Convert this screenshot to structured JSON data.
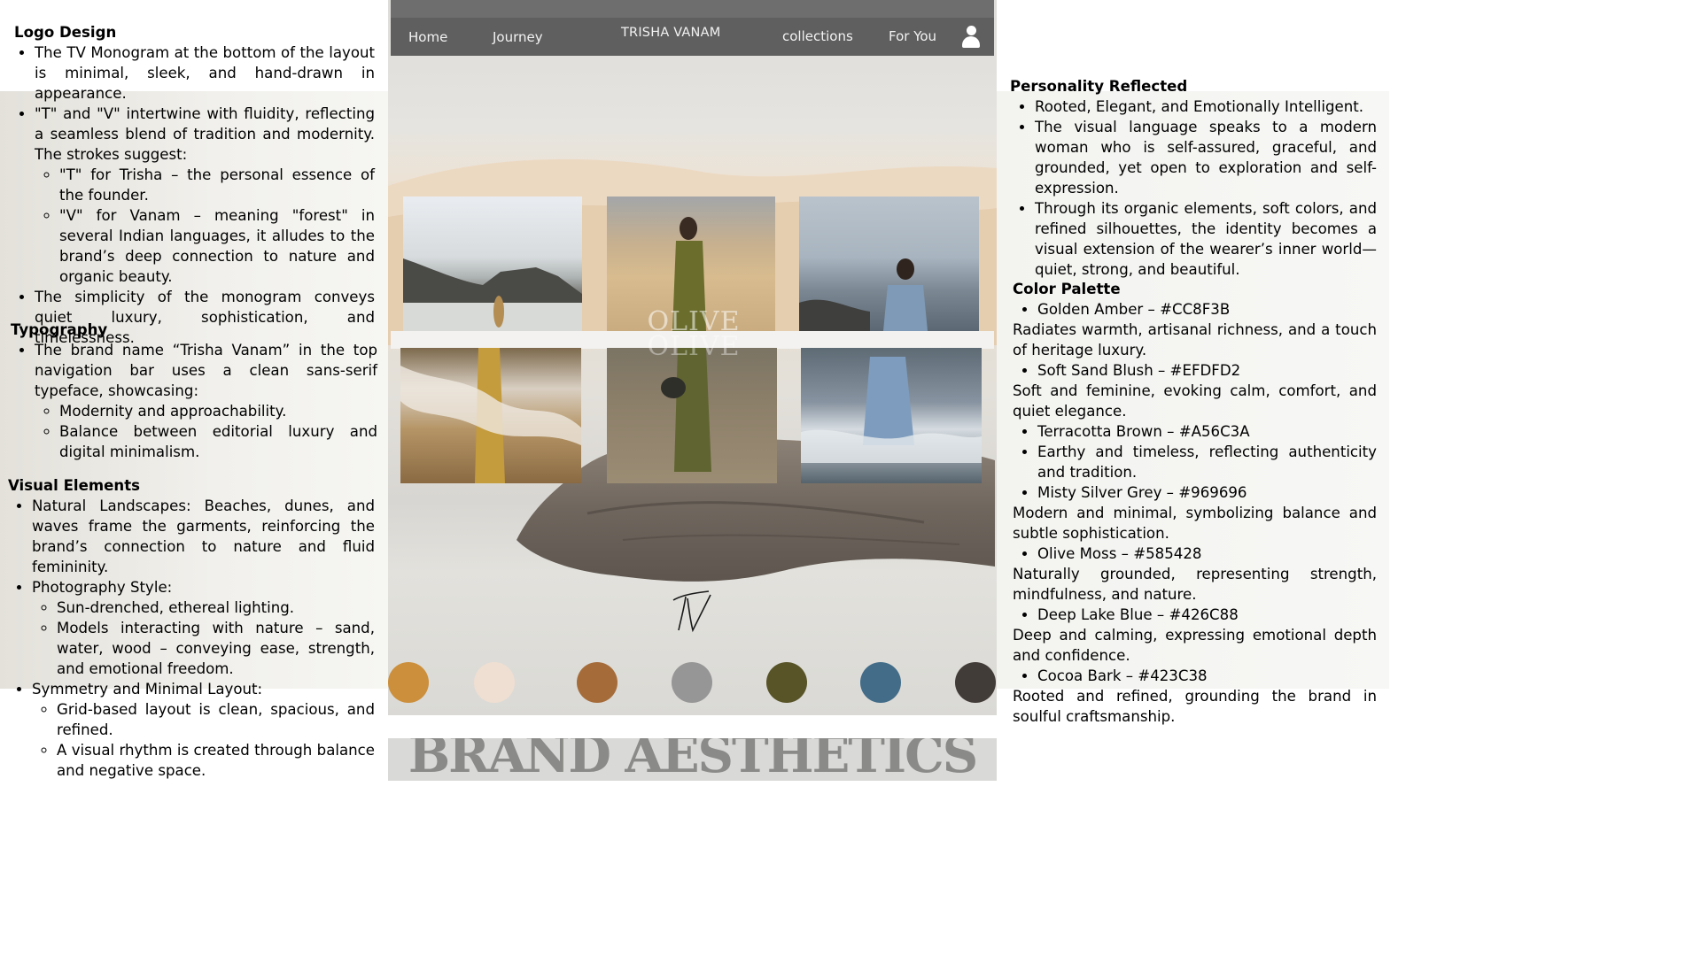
{
  "left": {
    "logo_design": {
      "heading": "Logo Design",
      "b1": "The TV Monogram at the bottom of the layout is minimal, sleek, and hand-drawn in appearance.",
      "b2": "\"T\" and \"V\" intertwine with fluidity, reflecting a seamless blend of tradition and modernity. The strokes suggest:",
      "b2a": "\"T\" for Trisha – the personal essence of the founder.",
      "b2b": "\"V\" for Vanam – meaning \"forest\" in several Indian languages, it alludes to the brand’s deep connection to nature and organic beauty.",
      "b3": "The simplicity of the monogram conveys quiet luxury, sophistication, and timelessness."
    },
    "typography": {
      "heading": "Typography",
      "b1": "The brand name “Trisha Vanam” in the top navigation bar uses a clean sans-serif typeface, showcasing:",
      "b1a": "Modernity and approachability.",
      "b1b": "Balance between editorial luxury and digital minimalism."
    },
    "visual_elements": {
      "heading": "Visual Elements",
      "b1": "Natural Landscapes: Beaches, dunes, and waves frame the garments, reinforcing the brand’s connection to nature and fluid femininity.",
      "b2": "Photography Style:",
      "b2a": "Sun-drenched, ethereal lighting.",
      "b2b": "Models interacting with nature – sand, water, wood – conveying ease, strength, and emotional freedom.",
      "b3": "Symmetry and Minimal Layout:",
      "b3a": "Grid-based layout is clean, spacious, and refined.",
      "b3b": "A visual rhythm is created through balance and negative space."
    }
  },
  "nav": {
    "home": "Home",
    "journey": "Journey",
    "brand": "TRISHA VANAM",
    "collections": "collections",
    "for_you": "For You",
    "user_icon": "user-icon"
  },
  "overlay_text": "OLIVE",
  "swatches": [
    {
      "name": "Golden Amber",
      "color": "#CC8F3B"
    },
    {
      "name": "Soft Sand Blush",
      "color": "#EFDFD2"
    },
    {
      "name": "Terracotta Brown",
      "color": "#A56C3A"
    },
    {
      "name": "Misty Silver Grey",
      "color": "#969696"
    },
    {
      "name": "Olive Moss",
      "color": "#585428"
    },
    {
      "name": "Deep Lake Blue",
      "color": "#426C88"
    },
    {
      "name": "Cocoa Bark",
      "color": "#423C38"
    }
  ],
  "page_title": "BRAND AESTHETICS",
  "right": {
    "personality": {
      "heading": "Personality Reflected",
      "b1": "Rooted, Elegant, and Emotionally Intelligent.",
      "b2": "The visual language speaks to a modern woman who is self-assured, graceful, and grounded, yet open to exploration and self-expression.",
      "b3": "Through its organic elements, soft colors, and refined silhouettes, the identity becomes a visual extension of the wearer’s inner world—quiet, strong, and beautiful."
    },
    "palette": {
      "heading": "Color Palette",
      "c1": "Golden Amber – #CC8F3B",
      "c1_desc": "Radiates warmth, artisanal richness, and a touch of heritage luxury.",
      "c2": "Soft Sand Blush – #EFDFD2",
      "c2_desc": "Soft and feminine, evoking calm, comfort, and quiet elegance.",
      "c3": "Terracotta Brown – #A56C3A",
      "c3_desc": "Earthy and timeless, reflecting authenticity and tradition.",
      "c4": "Misty Silver Grey – #969696",
      "c4_desc": "Modern and minimal, symbolizing balance and subtle sophistication.",
      "c5": "Olive Moss – #585428",
      "c5_desc": "Naturally grounded, representing strength, mindfulness, and nature.",
      "c6": "Deep Lake Blue – #426C88",
      "c6_desc": "Deep and calming, expressing emotional depth and confidence.",
      "c7": "Cocoa Bark – #423C38",
      "c7_desc": "Rooted and refined, grounding the brand in soulful craftsmanship."
    }
  }
}
